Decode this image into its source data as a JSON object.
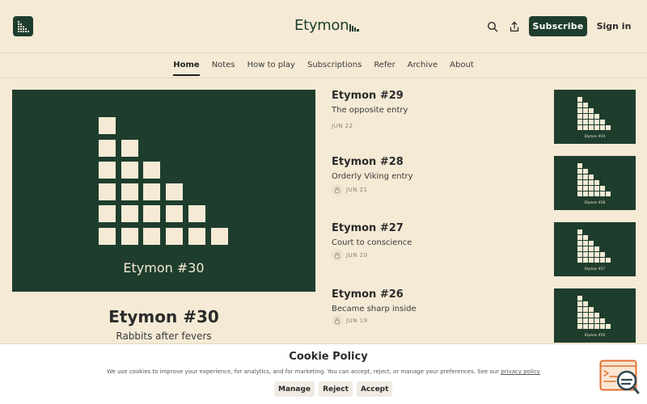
{
  "header": {
    "brand": "Etymon",
    "subscribe_label": "Subscribe",
    "signin_label": "Sign in",
    "search_icon": "search-icon",
    "share_icon": "share-icon"
  },
  "nav": {
    "items": [
      "Home",
      "Notes",
      "How to play",
      "Subscriptions",
      "Refer",
      "Archive",
      "About"
    ],
    "active": "Home"
  },
  "featured": {
    "image_caption": "Etymon #30",
    "title": "Etymon #30",
    "subtitle": "Rabbits after fevers"
  },
  "posts": [
    {
      "title": "Etymon #29",
      "subtitle": "The opposite entry",
      "date": "JUN 22",
      "locked": false,
      "thumb_caption": "Etymon #29"
    },
    {
      "title": "Etymon #28",
      "subtitle": "Orderly Viking entry",
      "date": "JUN 21",
      "locked": true,
      "thumb_caption": "Etymon #28"
    },
    {
      "title": "Etymon #27",
      "subtitle": "Court to conscience",
      "date": "JUN 20",
      "locked": true,
      "thumb_caption": "Etymon #27"
    },
    {
      "title": "Etymon #26",
      "subtitle": "Became sharp inside",
      "date": "JUN 19",
      "locked": true,
      "thumb_caption": "Etymon #26"
    }
  ],
  "cookie": {
    "title": "Cookie Policy",
    "text": "We use cookies to improve your experience, for analytics, and for marketing. You can accept, reject, or manage your preferences. See our",
    "link": "privacy policy",
    "buttons": [
      "Manage",
      "Reject",
      "Accept"
    ]
  },
  "colors": {
    "background": "#f5ead5",
    "brand_green": "#1e3d2d",
    "cream": "#f5ead5"
  }
}
